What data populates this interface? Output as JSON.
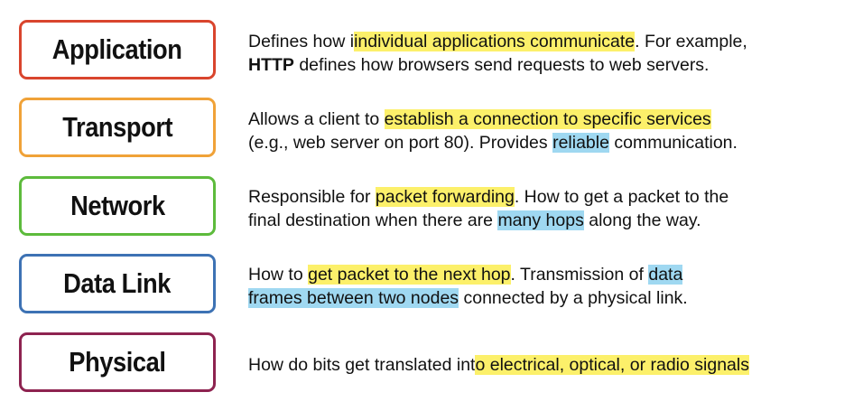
{
  "layers": [
    {
      "name": "Application",
      "color": "#d9452d",
      "lines": [
        [
          {
            "t": "Defines how i"
          },
          {
            "t": "individual applications communicate",
            "hl": "yellow"
          },
          {
            "t": ". For example,"
          }
        ],
        [
          {
            "t": "HTTP",
            "bold": true
          },
          {
            "t": " defines how browsers send requests to web servers."
          }
        ]
      ]
    },
    {
      "name": "Transport",
      "color": "#f0a238",
      "lines": [
        [
          {
            "t": "Allows a client to "
          },
          {
            "t": "establish a connection to specific services",
            "hl": "yellow"
          }
        ],
        [
          {
            "t": "(e.g., web server on port 80). Provides "
          },
          {
            "t": "reliable",
            "hl": "blue"
          },
          {
            "t": " communication."
          }
        ]
      ]
    },
    {
      "name": "Network",
      "color": "#5dbb3c",
      "lines": [
        [
          {
            "t": "Responsible for "
          },
          {
            "t": "packet forwarding",
            "hl": "yellow"
          },
          {
            "t": ". How to get a packet to the"
          }
        ],
        [
          {
            "t": "final destination when there are "
          },
          {
            "t": "many hops",
            "hl": "blue"
          },
          {
            "t": " along the way."
          }
        ]
      ]
    },
    {
      "name": "Data Link",
      "color": "#3d72b4",
      "lines": [
        [
          {
            "t": "How to "
          },
          {
            "t": "get packet to the next hop",
            "hl": "yellow"
          },
          {
            "t": ". Transmission of "
          },
          {
            "t": "data ",
            "hl": "blue"
          }
        ],
        [
          {
            "t": "frames between two nodes",
            "hl": "blue"
          },
          {
            "t": " connected by a physical link."
          }
        ]
      ]
    },
    {
      "name": "Physical",
      "color": "#8e2350",
      "lines": [
        [
          {
            "t": "How do bits get translated int"
          },
          {
            "t": "o electrical, optical, or radio signals",
            "hl": "yellow"
          }
        ]
      ]
    }
  ],
  "colors": {
    "highlight_yellow": "#fcf06a",
    "highlight_blue": "#9fd8f1"
  }
}
